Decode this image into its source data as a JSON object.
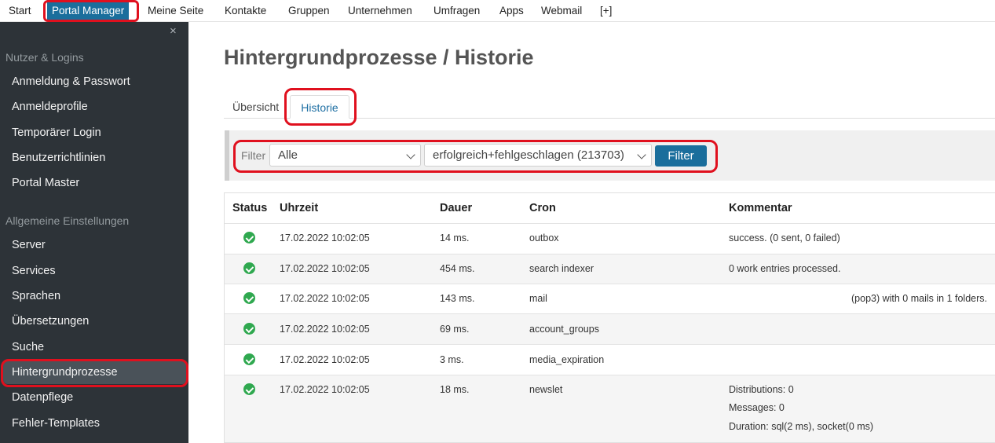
{
  "topnav": {
    "items": [
      "Start",
      "Portal Manager",
      "Meine Seite",
      "Kontakte",
      "Gruppen",
      "Unternehmen",
      "Umfragen",
      "Apps",
      "Webmail",
      "[+]"
    ]
  },
  "sidebar": {
    "close_glyph": "×",
    "section_users": "Nutzer & Logins",
    "users_items": [
      "Anmeldung & Passwort",
      "Anmeldeprofile",
      "Temporärer Login",
      "Benutzerrichtlinien",
      "Portal Master"
    ],
    "section_general": "Allgemeine Einstellungen",
    "general_items": [
      "Server",
      "Services",
      "Sprachen",
      "Übersetzungen",
      "Suche",
      "Hintergrundprozesse",
      "Datenpflege",
      "Fehler-Templates"
    ]
  },
  "main": {
    "title": "Hintergrundprozesse / Historie",
    "tabs": [
      "Übersicht",
      "Historie"
    ],
    "filter": {
      "label": "Filter",
      "select_type": "Alle",
      "select_status": "erfolgreich+fehlgeschlagen (213703)",
      "button": "Filter"
    },
    "table": {
      "headers": [
        "Status",
        "Uhrzeit",
        "Dauer",
        "Cron",
        "Kommentar"
      ],
      "rows": [
        {
          "status": "ok",
          "time": "17.02.2022 10:02:05",
          "duration": "14 ms.",
          "cron": "outbox",
          "comment": [
            "success. (0 sent, 0 failed)"
          ]
        },
        {
          "status": "ok",
          "time": "17.02.2022 10:02:05",
          "duration": "454 ms.",
          "cron": "search indexer",
          "comment": [
            "0 work entries processed."
          ]
        },
        {
          "status": "ok",
          "time": "17.02.2022 10:02:05",
          "duration": "143 ms.",
          "cron": "mail",
          "comment": [
            "(pop3) with 0 mails in 1 folders."
          ]
        },
        {
          "status": "ok",
          "time": "17.02.2022 10:02:05",
          "duration": "69 ms.",
          "cron": "account_groups",
          "comment": []
        },
        {
          "status": "ok",
          "time": "17.02.2022 10:02:05",
          "duration": "3 ms.",
          "cron": "media_expiration",
          "comment": []
        },
        {
          "status": "ok",
          "time": "17.02.2022 10:02:05",
          "duration": "18 ms.",
          "cron": "newslet",
          "comment": [
            "Distributions: 0",
            "Messages: 0",
            "Duration: sql(2 ms), socket(0 ms)"
          ]
        }
      ]
    }
  },
  "colors": {
    "accent": "#1a6e9c",
    "sidebar_bg": "#2d3338",
    "success": "#2fa84f",
    "highlight": "#e0101e"
  },
  "icons": [
    "close-icon",
    "chevron-down-icon",
    "success-check-icon"
  ]
}
